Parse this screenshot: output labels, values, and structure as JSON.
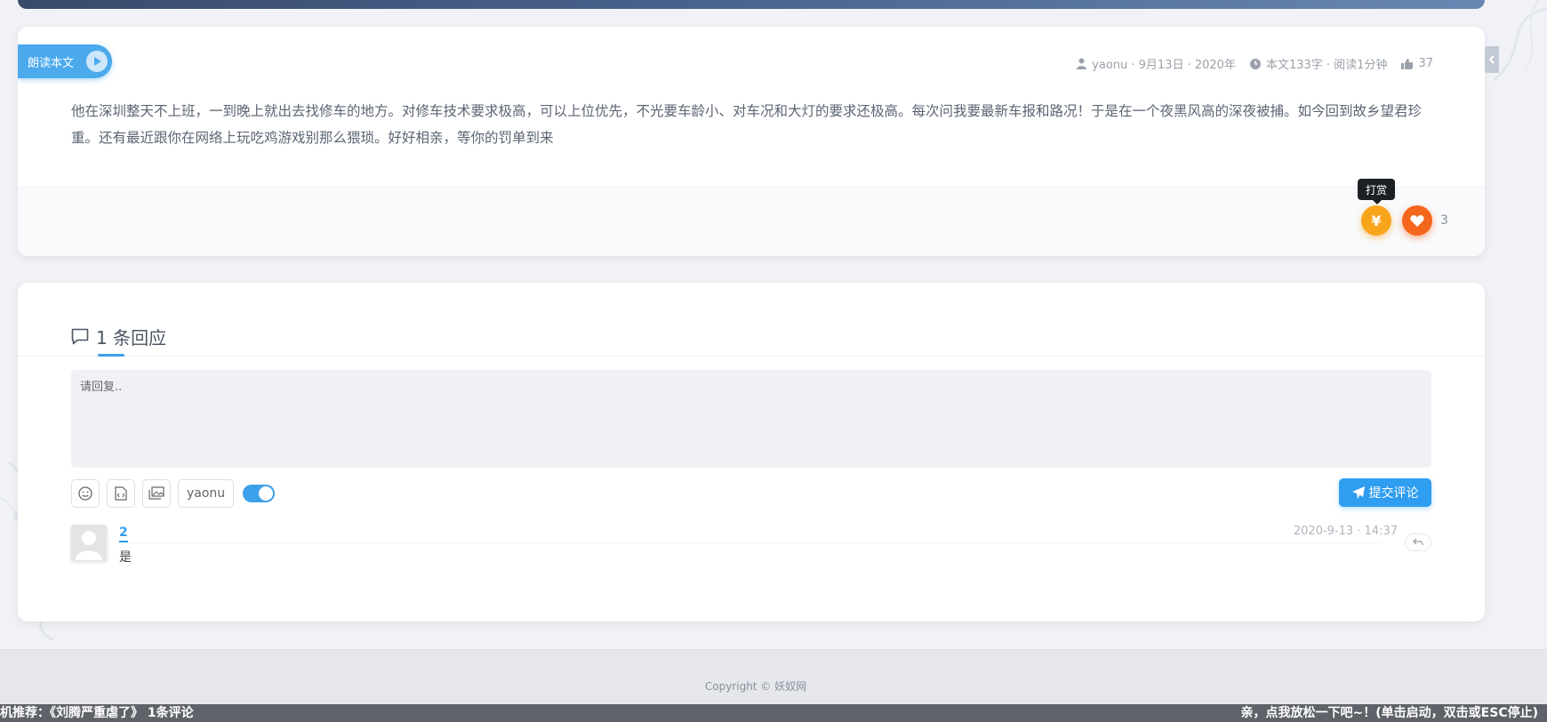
{
  "article": {
    "read_aloud_label": "朗读本文",
    "meta": {
      "author_date": "yaonu · 9月13日 · 2020年",
      "stats": "本文133字 · 阅读1分钟",
      "views": "37"
    },
    "body": "他在深圳整天不上班，一到晚上就出去找修车的地方。对修车技术要求极高，可以上位优先，不光要车龄小、对车况和大灯的要求还极高。每次问我要最新车报和路况！于是在一个夜黑风高的深夜被捕。如今回到故乡望君珍重。还有最近跟你在网络上玩吃鸡游戏别那么猥琐。好好相亲，等你的罚单到来",
    "reward_tooltip": "打赏",
    "reward_symbol": "¥",
    "like_count": "3"
  },
  "comments": {
    "count_label": "1 条回应",
    "reply_placeholder": "请回复..",
    "name_value": "yaonu",
    "submit_label": "提交评论",
    "items": [
      {
        "author": "2",
        "body": "是",
        "time": "2020-9-13 · 14:37"
      }
    ]
  },
  "footer": {
    "copyright": "Copyright © 妖奴网"
  },
  "bottom_bar": {
    "left_text": "机推荐：《刘腾严重虐了》  1条评论",
    "right_text": "亲，点我放松一下吧~！(单击启动，双击或ESC停止)"
  },
  "colors": {
    "accent": "#2f9df0",
    "reward": "#f9a51c",
    "like": "#f5661d"
  }
}
